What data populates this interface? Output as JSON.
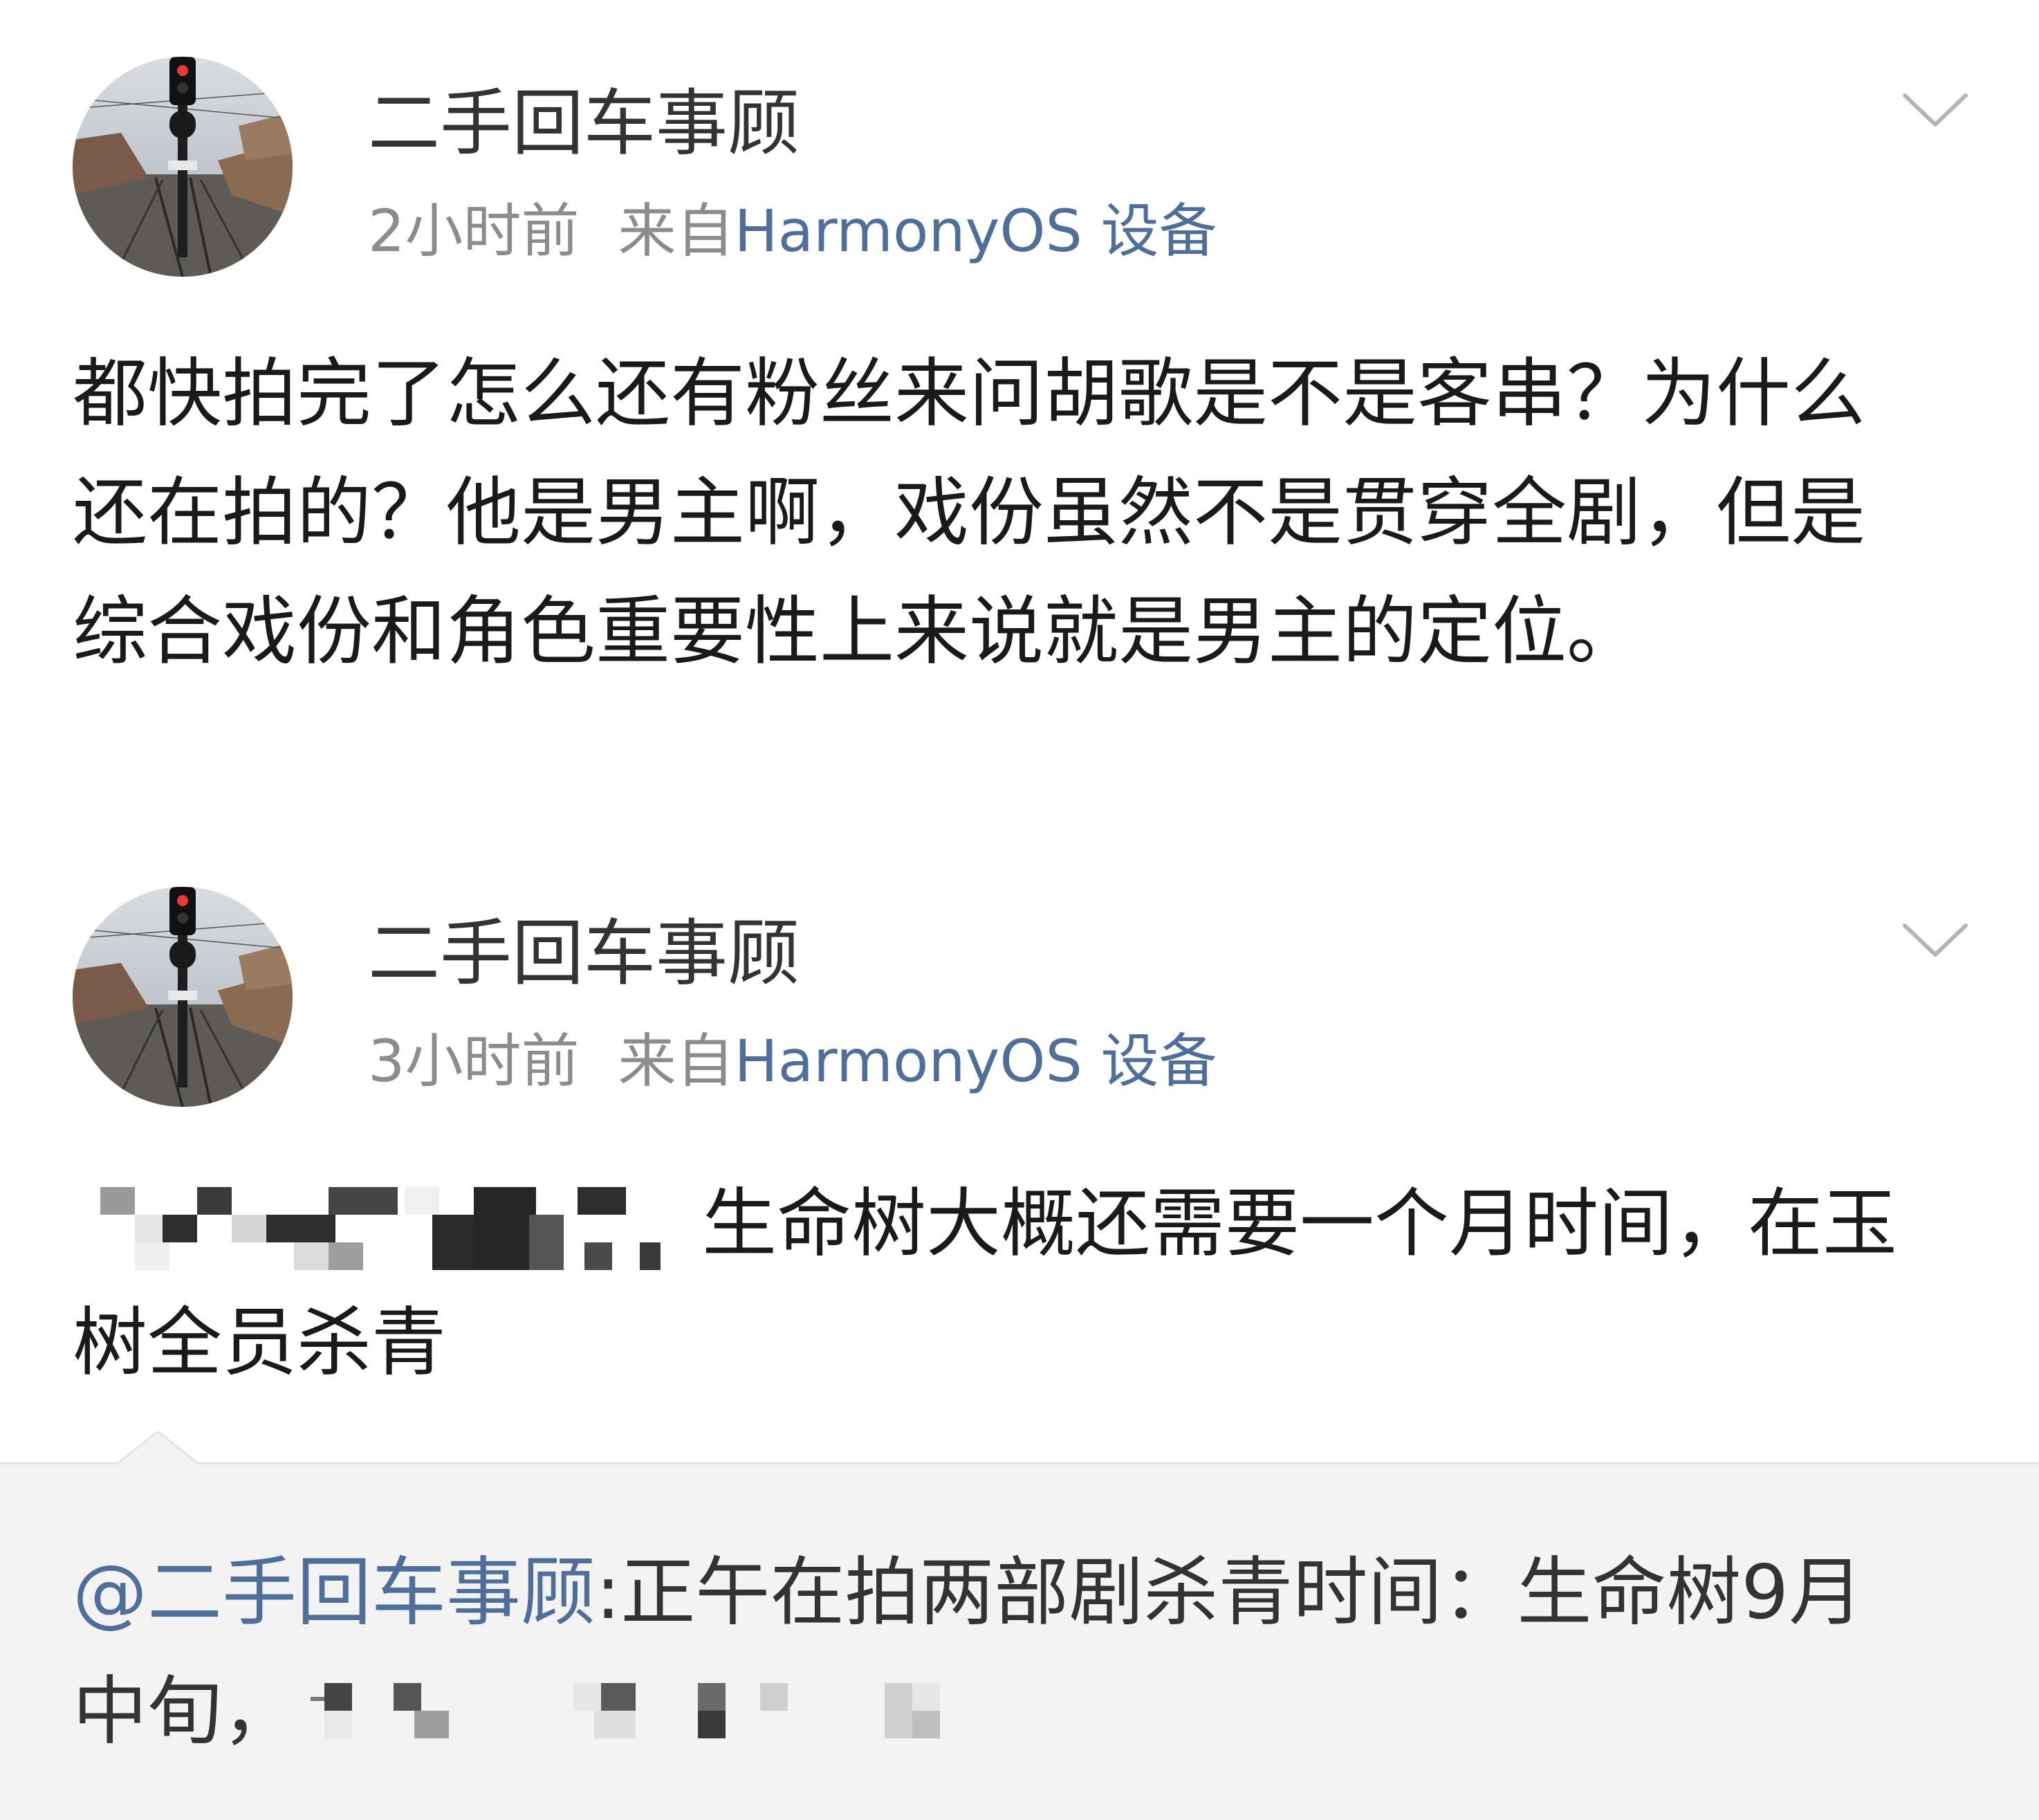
{
  "posts": [
    {
      "username": "二手回车事顾",
      "time": "2小时前",
      "source_prefix": "来自",
      "source_device": "HarmonyOS 设备",
      "text": "都快拍完了怎么还有粉丝来问胡歌是不是客串？为什么还在拍的？他是男主啊，戏份虽然不是贯穿全剧，但是综合戏份和角色重要性上来说就是男主的定位。"
    },
    {
      "username": "二手回车事顾",
      "time": "3小时前",
      "source_prefix": "来自",
      "source_device": "HarmonyOS 设备",
      "text": "生命树大概还需要一个月时间，在玉树全员杀青"
    }
  ],
  "quote": {
    "mention": "@二手回车事顾",
    "text_line1": ":正午在拍两部剧杀青时间：生命树9月",
    "text_line2": "中旬，"
  },
  "icons": {
    "avatar": "avatar-railway-signal-photo",
    "menu": "chevron-down-icon"
  },
  "colors": {
    "link": "#4f6f9a",
    "meta_gray": "#8c8c8c",
    "quote_bg": "#f3f3f3"
  }
}
